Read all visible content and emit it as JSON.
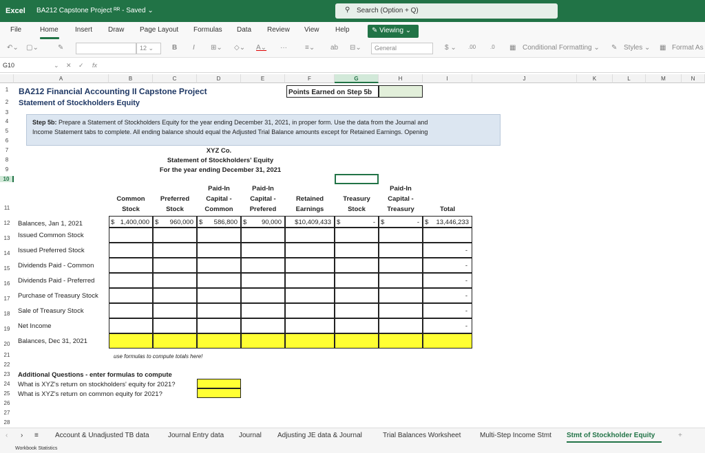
{
  "title_bar": {
    "app": "Excel",
    "doc": "BA212 Capstone Project ᴿᴿ - Saved ⌄",
    "search": "Search (Option + Q)"
  },
  "menu": {
    "items": [
      "File",
      "Home",
      "Insert",
      "Draw",
      "Page Layout",
      "Formulas",
      "Data",
      "Review",
      "View",
      "Help"
    ],
    "viewing": "Viewing ⌄"
  },
  "ribbon": {
    "font_size": "12",
    "number_format": "General",
    "conditional": "Conditional Formatting ⌄",
    "styles": "Styles ⌄",
    "format_as": "Format As"
  },
  "formula_bar": {
    "namebox": "G10",
    "fx": "fx"
  },
  "columns": [
    "A",
    "B",
    "C",
    "D",
    "E",
    "F",
    "G",
    "H",
    "I",
    "J",
    "K",
    "L",
    "M",
    "N"
  ],
  "rows": [
    "1",
    "2",
    "3",
    "4",
    "5",
    "6",
    "7",
    "8",
    "9",
    "10",
    "11",
    "12",
    "13",
    "14",
    "15",
    "16",
    "17",
    "18",
    "19",
    "20",
    "21",
    "22",
    "23",
    "24",
    "25",
    "26",
    "27",
    "28"
  ],
  "sheet": {
    "title": "BA212 Financial Accounting II Capstone Project",
    "subtitle": "Statement of Stockholders Equity",
    "points_label": "Points Earned on Step 5b",
    "instructions_1": "Prepare a Statement of Stockholders Equity for the year ending December 31, 2021, in proper form.  Use the data from the Journal and",
    "instructions_2": "Income Statement tabs to complete.  All ending balance should equal the Adjusted Trial Balance amounts except for Retained Earnings.  Opening",
    "step_label": "Step 5b:",
    "company": "XYZ Co.",
    "statement_title": "Statement of Stockholders' Equity",
    "period": "For the year ending December 31, 2021",
    "headers": [
      [
        "",
        "Common",
        "Stock"
      ],
      [
        "",
        "Preferred",
        "Stock"
      ],
      [
        "Paid-In",
        "Capital -",
        "Common"
      ],
      [
        "Paid-In",
        "Capital -",
        "Prefered"
      ],
      [
        "",
        "Retained",
        "Earnings"
      ],
      [
        "",
        "Treasury",
        "Stock"
      ],
      [
        "Paid-In",
        "Capital -",
        "Treasury"
      ],
      [
        "",
        "",
        "Total"
      ]
    ],
    "row_labels": [
      "Balances, Jan 1, 2021",
      "Issued Common Stock",
      "Issued Preferred Stock",
      "Dividends Paid - Common",
      "Dividends Paid - Preferred",
      "Purchase of Treasury Stock",
      "Sale of Treasury Stock",
      "Net Income",
      "Balances, Dec 31, 2021"
    ],
    "opening": [
      "1,400,000",
      "960,000",
      "586,800",
      "90,000",
      "$10,409,433",
      "-",
      "-",
      "13,446,233"
    ],
    "dash": "-",
    "dollar": "$",
    "note": "use formulas to compute totals here!",
    "additional_title": "Additional Questions - enter formulas to compute",
    "q1": "What is XYZ's return on stockholders' equity for 2021?",
    "q2": "What is XYZ's return on common equity for 2021?"
  },
  "tabs": [
    "Account & Unadjusted TB data",
    "Journal Entry data",
    "Journal",
    "Adjusting JE data & Journal",
    "Trial Balances Worksheet",
    "Multi-Step Income Stmt",
    "Stmt of Stockholder Equity"
  ],
  "status": "Workbook Statistics",
  "colors": {
    "excel_green": "#217346",
    "yellow": "#ffff33",
    "points_fill": "#e2efda",
    "instructions_fill": "#dce6f1"
  }
}
